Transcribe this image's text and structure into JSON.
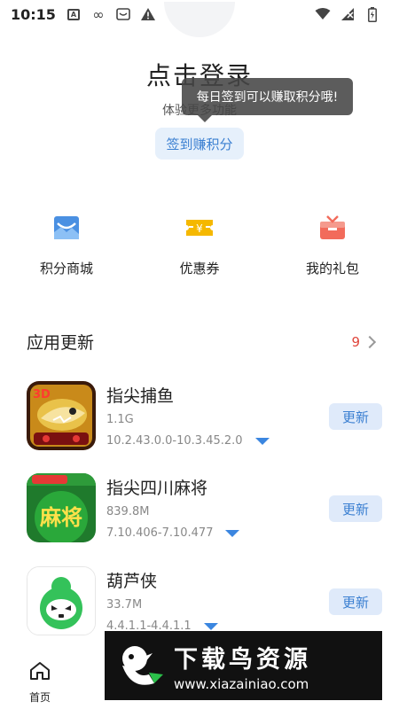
{
  "status_bar": {
    "time": "10:15",
    "icons": [
      "a-box-icon",
      "infinity-icon",
      "android-box-icon",
      "alert-icon"
    ],
    "right_icons": [
      "wifi-icon",
      "signal-icon",
      "battery-icon"
    ]
  },
  "header": {
    "login_title": "点击登录",
    "login_subtitle": "体验更多功能",
    "tooltip": "每日签到可以赚取积分哦!",
    "sign_button": "签到赚积分"
  },
  "shortcuts": [
    {
      "label": "积分商城",
      "icon": "points-mall-icon",
      "color": "#4a90e2"
    },
    {
      "label": "优惠券",
      "icon": "coupon-icon",
      "color": "#f5b800"
    },
    {
      "label": "我的礼包",
      "icon": "gift-icon",
      "color": "#f26b5b"
    }
  ],
  "updates": {
    "title": "应用更新",
    "count": "9",
    "apps": [
      {
        "name": "指尖捕鱼",
        "size": "1.1G",
        "version": "10.2.43.0.0-10.3.45.2.0",
        "button": "更新",
        "icon_text": "3D"
      },
      {
        "name": "指尖四川麻将",
        "size": "839.8M",
        "version": "7.10.406-7.10.477",
        "button": "更新",
        "icon_text": "麻将"
      },
      {
        "name": "葫芦侠",
        "size": "33.7M",
        "version": "4.4.1.1-4.4.1.1",
        "button": "更新"
      }
    ]
  },
  "bottom_nav": {
    "items": [
      {
        "label": "首页",
        "icon": "home-icon"
      }
    ]
  },
  "watermark": {
    "brand": "下载鸟资源",
    "url": "www.xiazainiao.com"
  },
  "colors": {
    "accent": "#3a7fd1",
    "button_bg": "#dfeafa",
    "count_red": "#e0463c"
  }
}
